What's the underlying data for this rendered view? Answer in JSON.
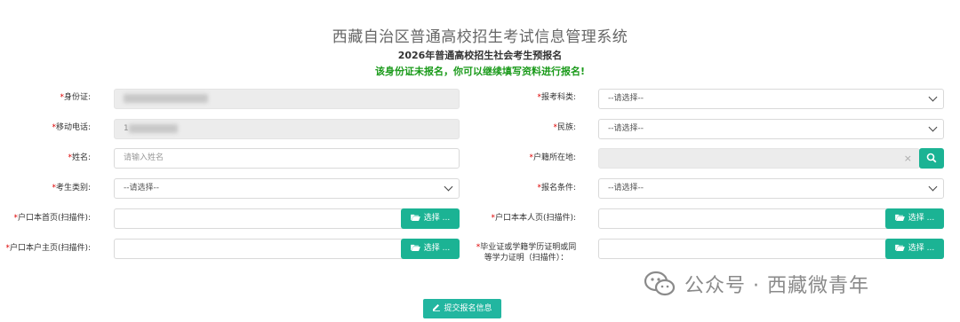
{
  "header": {
    "system_title": "西藏自治区普通高校招生考试信息管理系统",
    "subtitle": "2026年普通高校招生社会考生预报名",
    "notice": "该身份证未报名，你可以继续填写资料进行报名!"
  },
  "form": {
    "required_mark": "*",
    "id_card_label": "身份证:",
    "mobile_label": "移动电话:",
    "mobile_prefix": "1",
    "name_label": "姓名:",
    "name_placeholder": "请输入姓名",
    "candidate_type_label": "考生类别:",
    "hukou_first_label": "户口本首页(扫描件):",
    "hukou_owner_label": "户口本户主页(扫描件):",
    "subject_label": "报考科类:",
    "ethnicity_label": "民族:",
    "hukou_location_label": "户籍所在地:",
    "condition_label": "报名条件:",
    "hukou_self_label": "户口本本人页(扫描件):",
    "diploma_label_line1": "毕业证或学籍学历证明或同",
    "diploma_label_line2": "等学力证明（扫描件）：",
    "select_placeholder": "--请选择--",
    "choose_button": "选择 ...",
    "clear_symbol": "×"
  },
  "submit_label": "提交报名信息",
  "watermark": "公众号 · 西藏微青年",
  "colors": {
    "accent": "#1bb394",
    "notice": "#1a9a1a",
    "required": "#dd0000"
  },
  "icons": [
    "folder-open-icon",
    "search-icon",
    "edit-icon",
    "wechat-icon",
    "chevron-down-icon"
  ]
}
